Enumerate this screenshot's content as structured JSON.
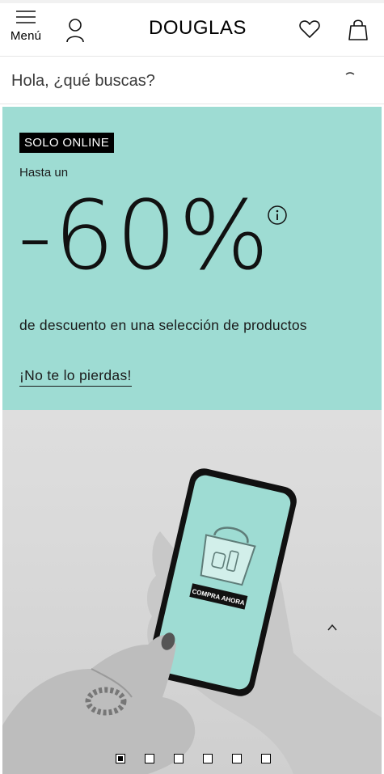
{
  "header": {
    "menu_label": "Menú",
    "logo_text": "DOUGLAS",
    "icons": [
      "hamburger-icon",
      "user-icon",
      "heart-icon",
      "shopping-bag-icon"
    ]
  },
  "search": {
    "placeholder": "Hola, ¿qué buscas?"
  },
  "promo": {
    "badge": "SOLO ONLINE",
    "prefix": "Hasta un",
    "discount": "-60%",
    "description": "de descuento en una selección de productos",
    "cta": "¡No te lo pierdas!",
    "info_icon": "info-icon",
    "background_color": "#9edcd3"
  },
  "hero": {
    "phone_button_label": "COMPRA AHORA",
    "screen_color": "#9edcd3"
  },
  "carousel": {
    "slide_count": 6,
    "active_index": 0
  },
  "scroll_top_icon": "chevron-up-icon"
}
